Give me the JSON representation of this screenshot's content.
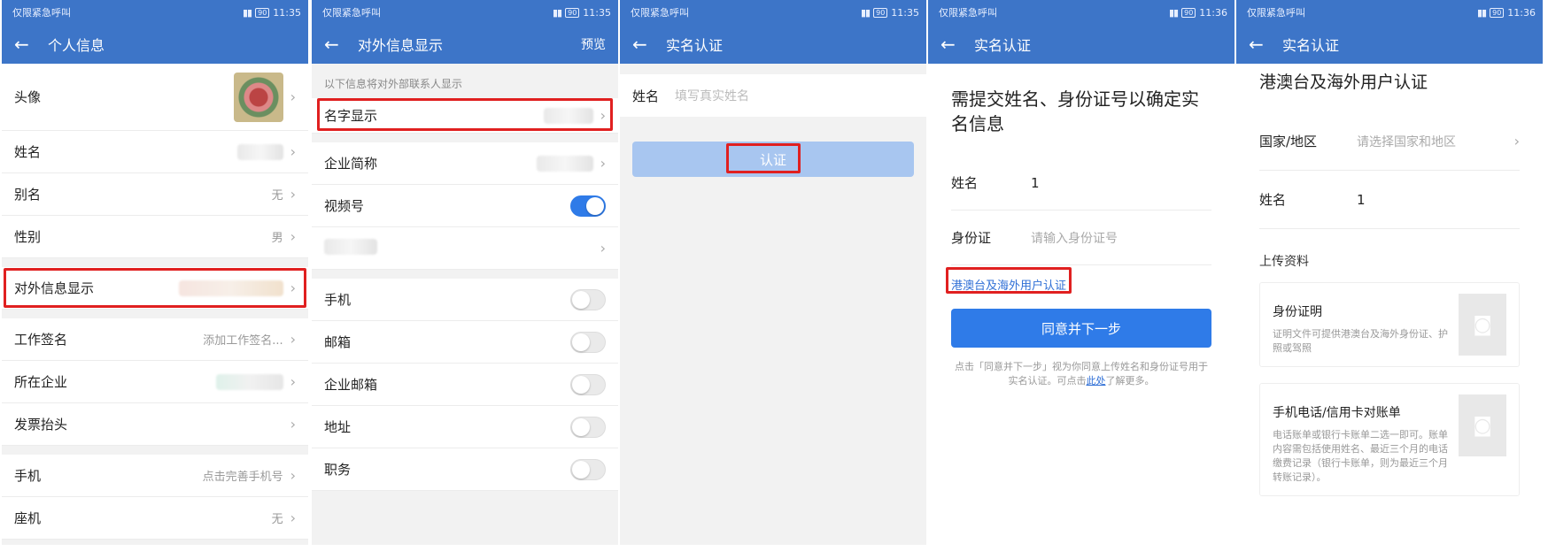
{
  "status": {
    "left": "仅限紧急呼叫",
    "battery": "90",
    "times": [
      "11:35",
      "11:35",
      "11:35",
      "11:36",
      "11:36"
    ]
  },
  "screen1": {
    "title": "个人信息",
    "rows": [
      {
        "label": "头像",
        "value": ""
      },
      {
        "label": "姓名",
        "value": ""
      },
      {
        "label": "别名",
        "value": "无"
      },
      {
        "label": "性别",
        "value": "男"
      },
      {
        "label": "对外信息显示",
        "value": ""
      },
      {
        "label": "工作签名",
        "value": "添加工作签名..."
      },
      {
        "label": "所在企业",
        "value": ""
      },
      {
        "label": "发票抬头",
        "value": ""
      },
      {
        "label": "手机",
        "value": "点击完善手机号"
      },
      {
        "label": "座机",
        "value": "无"
      }
    ]
  },
  "screen2": {
    "title": "对外信息显示",
    "action": "预览",
    "hint": "以下信息将对外部联系人显示",
    "rows": [
      {
        "label": "名字显示"
      },
      {
        "label": "企业简称"
      },
      {
        "label": "视频号"
      },
      {
        "label": ""
      },
      {
        "label": "手机"
      },
      {
        "label": "邮箱"
      },
      {
        "label": "企业邮箱"
      },
      {
        "label": "地址"
      },
      {
        "label": "职务"
      }
    ],
    "toggles": {
      "video": true,
      "phone": false,
      "email": false,
      "corp_email": false,
      "address": false,
      "position": false
    }
  },
  "screen3": {
    "title": "实名认证",
    "name_label": "姓名",
    "name_placeholder": "填写真实姓名",
    "button": "认证"
  },
  "screen4": {
    "title": "实名认证",
    "headline": "需提交姓名、身份证号以确定实名信息",
    "name_label": "姓名",
    "name_value": "1",
    "id_label": "身份证",
    "id_placeholder": "请输入身份证号",
    "link": "港澳台及海外用户认证",
    "button": "同意并下一步",
    "fine_pre": "点击「同意并下一步」视为你同意上传姓名和身份证号用于实名认证。可点击",
    "fine_link": "此处",
    "fine_post": "了解更多。"
  },
  "screen5": {
    "title": "实名认证",
    "headline": "港澳台及海外用户认证",
    "country_label": "国家/地区",
    "country_placeholder": "请选择国家和地区",
    "name_label": "姓名",
    "name_value": "1",
    "upload_label": "上传资料",
    "cards": [
      {
        "title": "身份证明",
        "desc": "证明文件可提供港澳台及海外身份证、护照或驾照"
      },
      {
        "title": "手机电话/信用卡对账单",
        "desc": "电话账单或银行卡账单二选一即可。账单内容需包括使用姓名、最近三个月的电话缴费记录（银行卡账单，则为最近三个月转账记录）。"
      }
    ]
  },
  "colors": {
    "appbar": "#3d75c8",
    "primary": "#2f7be8",
    "highlight": "#e02020",
    "link": "#2f6fd6"
  }
}
